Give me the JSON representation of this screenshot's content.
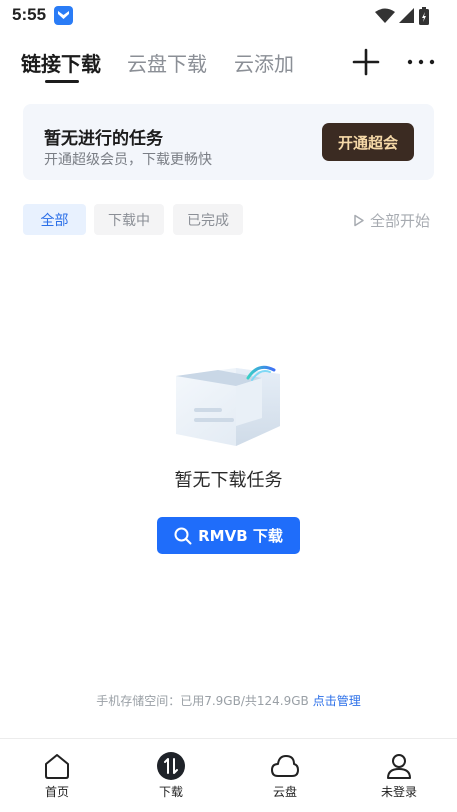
{
  "status_bar": {
    "time": "5:55"
  },
  "top_tabs": [
    {
      "label": "链接下载",
      "active": true
    },
    {
      "label": "云盘下载",
      "active": false
    },
    {
      "label": "云添加",
      "active": false
    }
  ],
  "promo": {
    "title": "暂无进行的任务",
    "subtitle": "开通超级会员，下载更畅快",
    "button": "开通超会"
  },
  "filters": [
    {
      "label": "全部",
      "active": true
    },
    {
      "label": "下载中",
      "active": false
    },
    {
      "label": "已完成",
      "active": false
    }
  ],
  "start_all": "全部开始",
  "empty": {
    "text": "暂无下载任务",
    "search_button": "RMVB 下载"
  },
  "storage": {
    "text": "手机存储空间：已用7.9GB/共124.9GB",
    "link": "点击管理"
  },
  "bottom_nav": [
    {
      "label": "首页",
      "icon": "home-icon"
    },
    {
      "label": "下载",
      "icon": "download-icon"
    },
    {
      "label": "云盘",
      "icon": "cloud-icon"
    },
    {
      "label": "未登录",
      "icon": "user-icon"
    }
  ],
  "colors": {
    "accent": "#1f6dfa",
    "promo_button": "#3b2b22",
    "promo_text": "#f6d9a8"
  }
}
